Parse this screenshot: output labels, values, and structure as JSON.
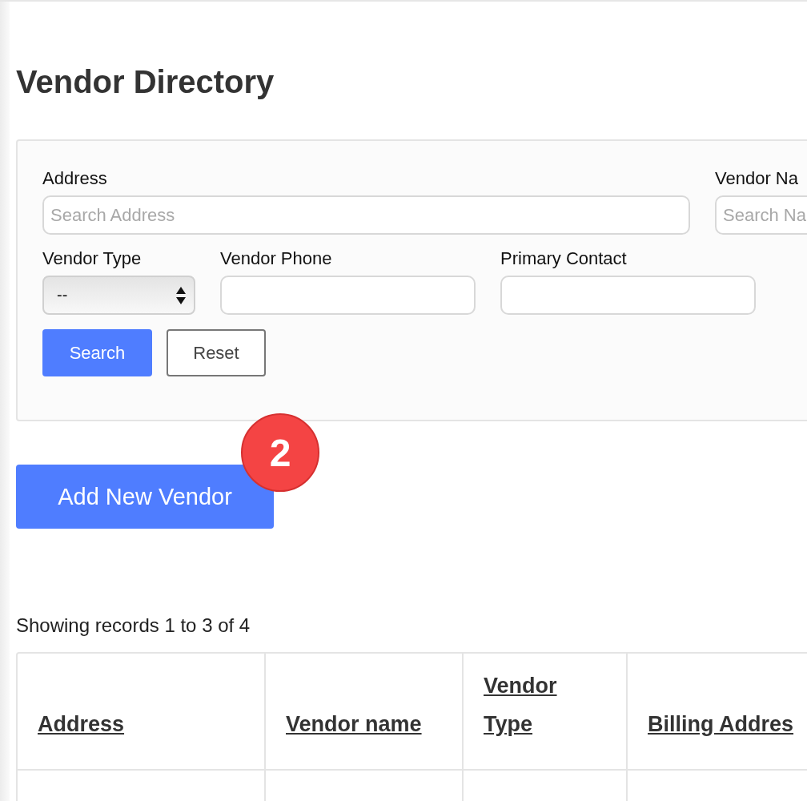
{
  "title": "Vendor Directory",
  "filters": {
    "fields": [
      {
        "kind": "text",
        "label": "Address",
        "placeholder": "Search Address"
      },
      {
        "kind": "text",
        "label": "Vendor Na",
        "placeholder": "Search Na"
      },
      {
        "kind": "select",
        "label": "Vendor Type",
        "value": "--"
      },
      {
        "kind": "text",
        "label": "Vendor Phone"
      },
      {
        "kind": "text",
        "label": "Primary Contact"
      }
    ],
    "buttons": [
      {
        "label": "Search",
        "kind": "primary"
      },
      {
        "label": "Reset",
        "kind": "outline"
      }
    ]
  },
  "add_button": {
    "label": "Add New Vendor",
    "badge": "2"
  },
  "records_summary": "Showing records 1 to 3 of 4",
  "table": {
    "columns": [
      "Address",
      "Vendor name",
      "Vendor Type",
      "Billing Addres"
    ]
  }
}
